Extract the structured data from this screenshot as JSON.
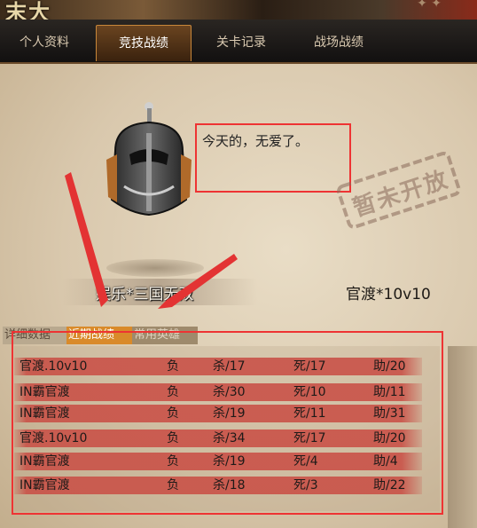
{
  "header": {
    "logo": "末大"
  },
  "tabs": [
    {
      "label": "个人资料",
      "active": false
    },
    {
      "label": "竞技战绩",
      "active": true
    },
    {
      "label": "关卡记录",
      "active": false
    },
    {
      "label": "战场战绩",
      "active": false
    }
  ],
  "profile": {
    "quote": "今天的，无爱了。",
    "stamp": "暂未开放",
    "player_name": "娱乐*三国无双",
    "mode": "官渡*10v10"
  },
  "subtabs": [
    {
      "label": "详细数据",
      "active": false
    },
    {
      "label": "近期战绩",
      "active": true
    },
    {
      "label": "常用英雄",
      "active": false
    }
  ],
  "records": [
    {
      "map": "官渡.10v10",
      "result": "负",
      "kills": "杀/17",
      "deaths": "死/17",
      "assists": "助/20"
    },
    {
      "map": "IN霸官渡",
      "result": "负",
      "kills": "杀/30",
      "deaths": "死/10",
      "assists": "助/11"
    },
    {
      "map": "IN霸官渡",
      "result": "负",
      "kills": "杀/19",
      "deaths": "死/11",
      "assists": "助/31"
    },
    {
      "map": "官渡.10v10",
      "result": "负",
      "kills": "杀/34",
      "deaths": "死/17",
      "assists": "助/20"
    },
    {
      "map": "IN霸官渡",
      "result": "负",
      "kills": "杀/19",
      "deaths": "死/4",
      "assists": "助/4"
    },
    {
      "map": "IN霸官渡",
      "result": "负",
      "kills": "杀/18",
      "deaths": "死/3",
      "assists": "助/22"
    }
  ],
  "colors": {
    "annotation": "#e33333",
    "row_bg": "#c95248",
    "active_subtab": "#d98a2a",
    "active_tab_border": "#c8873a"
  }
}
